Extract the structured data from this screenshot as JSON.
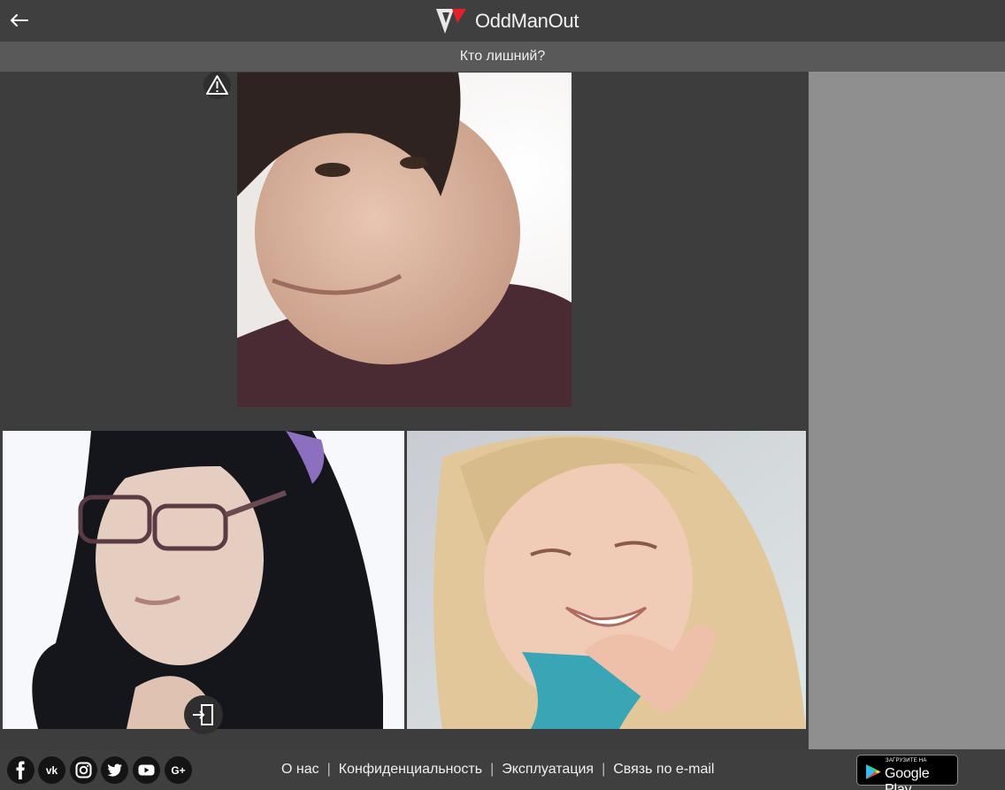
{
  "app": {
    "title": "OddManOut"
  },
  "header": {
    "question": "Кто лишний?"
  },
  "footer": {
    "links": [
      "О нас",
      "Конфиденциальность",
      "Эксплуатация",
      "Связь по e-mail"
    ],
    "separator": "|",
    "social": [
      "facebook-icon",
      "vk-icon",
      "instagram-icon",
      "twitter-icon",
      "youtube-icon",
      "google-plus-icon"
    ]
  },
  "store_badge": {
    "small": "ЗАГРУЗИТЕ НА",
    "big": "Google Play"
  },
  "colors": {
    "accent_red": "#e5202e",
    "sidebar": "#8f8f8f",
    "background": "#3d3d3d"
  }
}
